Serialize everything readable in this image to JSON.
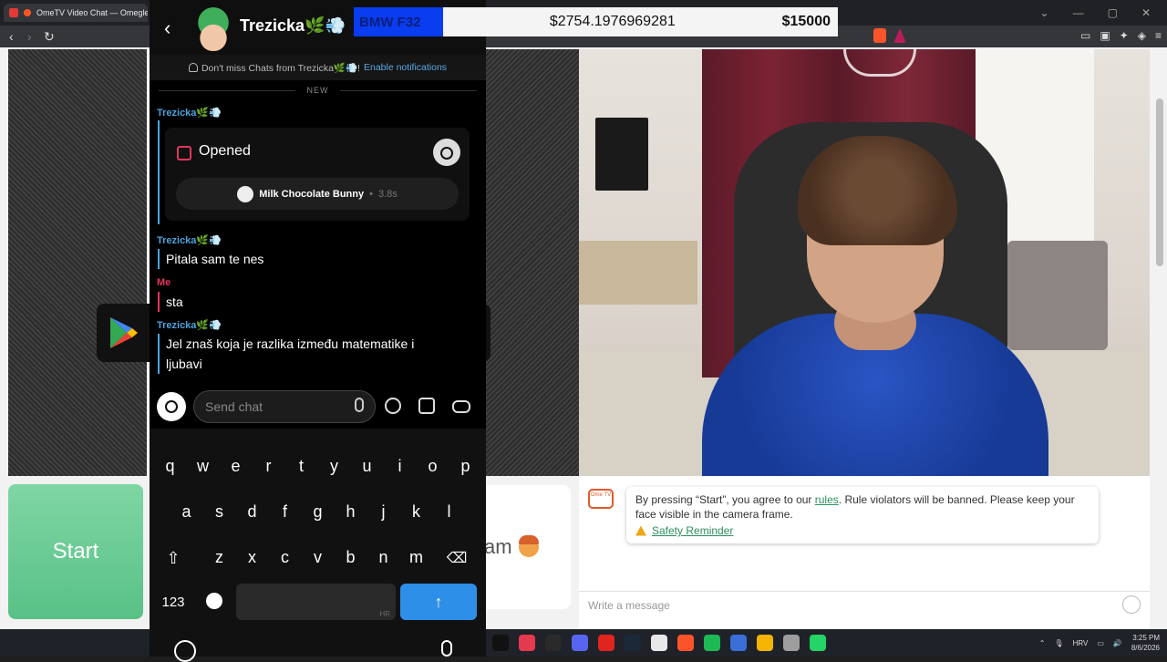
{
  "browser": {
    "tab_title": "OmeTV Video Chat — Omegle",
    "tab_close": "✕",
    "window_controls": [
      "⌄",
      "—",
      "▢",
      "✕"
    ],
    "nav_back": "‹",
    "nav_forward": "›",
    "nav_reload": "↻"
  },
  "overlay": {
    "goal_name": "BMW F32",
    "current_amount": "$2754.1976969281",
    "target_amount": "$15000"
  },
  "snapchat": {
    "back": "‹",
    "contact_name": "Trezicka🌿💨",
    "notification_text": "Don't miss Chats from Trezicka🌿💨!",
    "notification_action": "Enable notifications",
    "divider_label": "NEW",
    "snap_status": "Opened",
    "sound_name": "Milk Chocolate Bunny",
    "sound_dot": "•",
    "sound_duration": "3.8s",
    "messages": [
      {
        "sender": "Trezicka🌿💨",
        "text": "Pitala sam te nes"
      },
      {
        "sender": "Me",
        "text": "sta"
      },
      {
        "sender": "Trezicka🌿💨",
        "text": "Jel znaš koja je razlika između matematike i ljubavi"
      }
    ],
    "input_placeholder": "Send chat"
  },
  "keyboard": {
    "row1": [
      "q",
      "w",
      "e",
      "r",
      "t",
      "y",
      "u",
      "i",
      "o",
      "p"
    ],
    "row2": [
      "a",
      "s",
      "d",
      "f",
      "g",
      "h",
      "j",
      "k",
      "l"
    ],
    "row3": [
      "z",
      "x",
      "c",
      "v",
      "b",
      "n",
      "m"
    ],
    "shift": "⇧",
    "backspace": "⌫",
    "numbers": "123",
    "space_hint": "HR",
    "enter": "↑"
  },
  "ometv": {
    "start_label": "Start",
    "logo_text": "Ome TV",
    "mid_card_text": "am",
    "notice_prefix": "By pressing “Start”, you agree to our ",
    "notice_link": "rules",
    "notice_suffix": ". Rule violators will be banned. Please keep your face visible in the camera frame.",
    "safety_link": "Safety Reminder",
    "message_placeholder": "Write a message"
  },
  "taskbar": {
    "language": "HRV",
    "time": "3:25 PM",
    "date": "8/6/2026",
    "tray_arrow": "⌃",
    "app_icons": [
      {
        "name": "tiktok-icon",
        "color": "#111111"
      },
      {
        "name": "app-red-icon",
        "color": "#e53950"
      },
      {
        "name": "epic-games-icon",
        "color": "#2a2a2a"
      },
      {
        "name": "discord-icon",
        "color": "#5865f2"
      },
      {
        "name": "opera-icon",
        "color": "#e0241f"
      },
      {
        "name": "steam-icon",
        "color": "#1b2838"
      },
      {
        "name": "app-circle-icon",
        "color": "#e8e8e8"
      },
      {
        "name": "brave-icon",
        "color": "#fb542b"
      },
      {
        "name": "spotify-icon",
        "color": "#1db954"
      },
      {
        "name": "app-blue-icon",
        "color": "#3a6fd8"
      },
      {
        "name": "chrome-icon",
        "color": "#f4b400"
      },
      {
        "name": "app-multi-icon",
        "color": "#9e9e9e"
      },
      {
        "name": "whatsapp-icon",
        "color": "#25d366"
      }
    ]
  },
  "colors": {
    "start_green": "#5cc58a",
    "snap_blue": "#4aa3df",
    "snap_red": "#e2355c",
    "overlay_blue": "#0a3cf0"
  }
}
